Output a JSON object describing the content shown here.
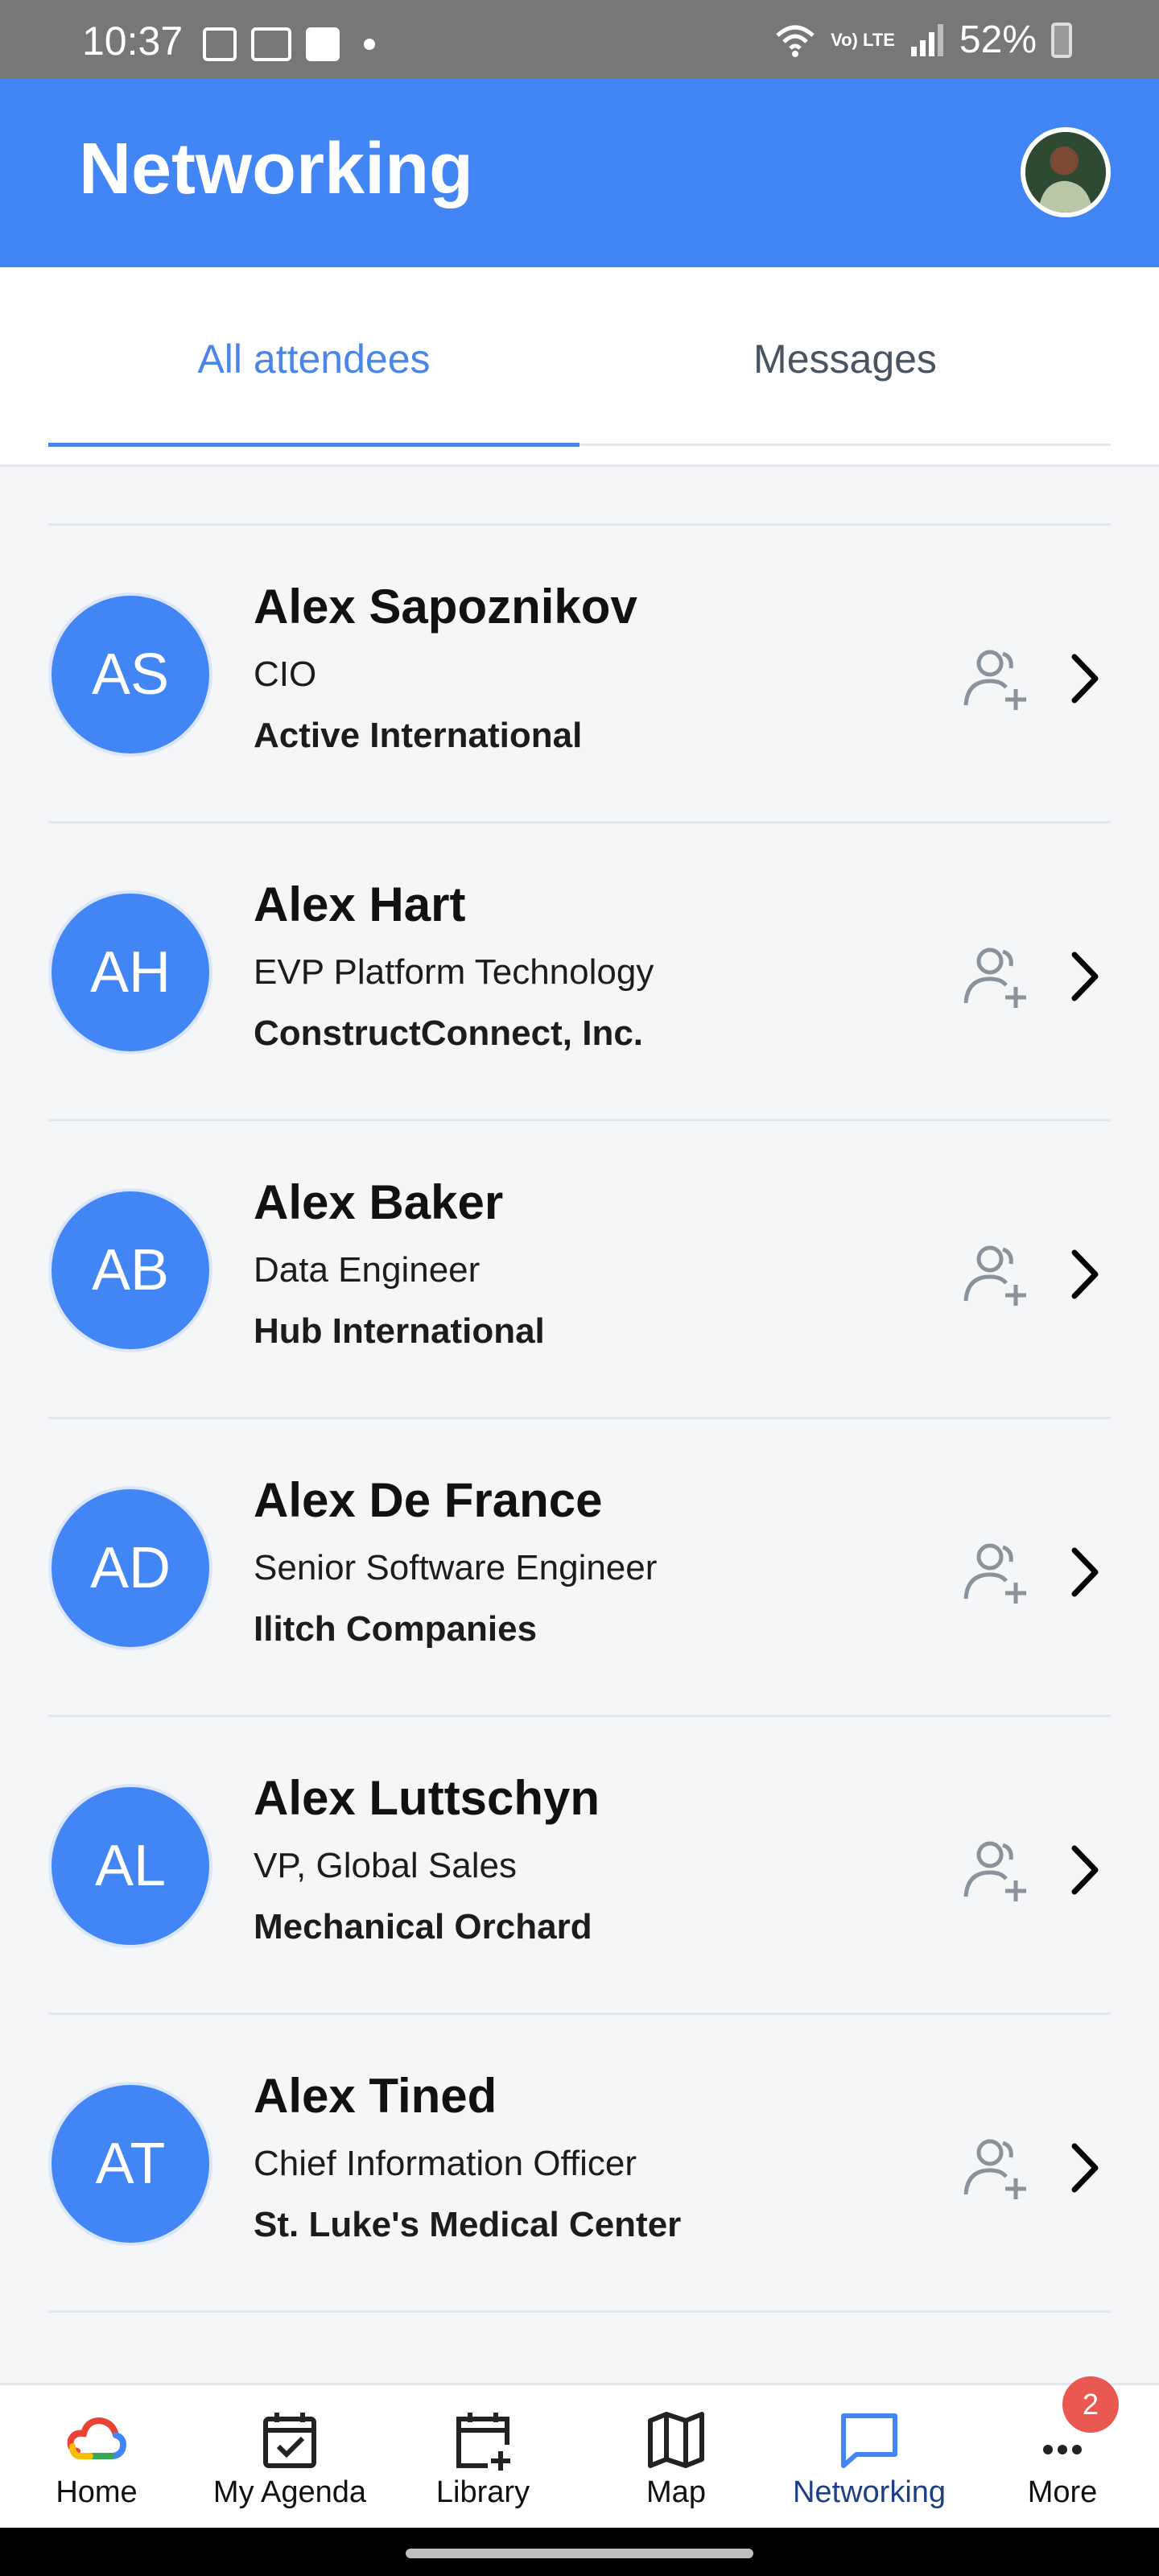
{
  "status_bar": {
    "time": "10:37",
    "lte_label": "Vo) LTE",
    "battery": "52%"
  },
  "header": {
    "title": "Networking"
  },
  "tabs": [
    {
      "label": "All attendees",
      "active": true
    },
    {
      "label": "Messages",
      "active": false
    }
  ],
  "attendees": [
    {
      "initials": "AS",
      "name": "Alex Sapoznikov",
      "role": "CIO",
      "company": "Active International"
    },
    {
      "initials": "AH",
      "name": "Alex Hart",
      "role": "EVP Platform Technology",
      "company": "ConstructConnect, Inc."
    },
    {
      "initials": "AB",
      "name": "Alex Baker",
      "role": "Data Engineer",
      "company": "Hub International"
    },
    {
      "initials": "AD",
      "name": "Alex De France",
      "role": "Senior Software Engineer",
      "company": "Ilitch Companies"
    },
    {
      "initials": "AL",
      "name": "Alex Luttschyn",
      "role": "VP, Global Sales",
      "company": "Mechanical Orchard"
    },
    {
      "initials": "AT",
      "name": "Alex Tined",
      "role": "Chief Information Officer",
      "company": "St. Luke's Medical Center"
    }
  ],
  "bottom_nav": {
    "items": [
      {
        "label": "Home",
        "icon": "google-cloud-icon"
      },
      {
        "label": "My Agenda",
        "icon": "calendar-check-icon"
      },
      {
        "label": "Library",
        "icon": "calendar-plus-icon"
      },
      {
        "label": "Map",
        "icon": "map-icon"
      },
      {
        "label": "Networking",
        "icon": "chat-icon",
        "active": true
      },
      {
        "label": "More",
        "icon": "more-icon"
      }
    ],
    "more_badge": "2"
  },
  "colors": {
    "primary": "#4285f4",
    "active_tab": "#4a86e8",
    "badge": "#e95951",
    "list_bg": "#f5f6f8"
  }
}
